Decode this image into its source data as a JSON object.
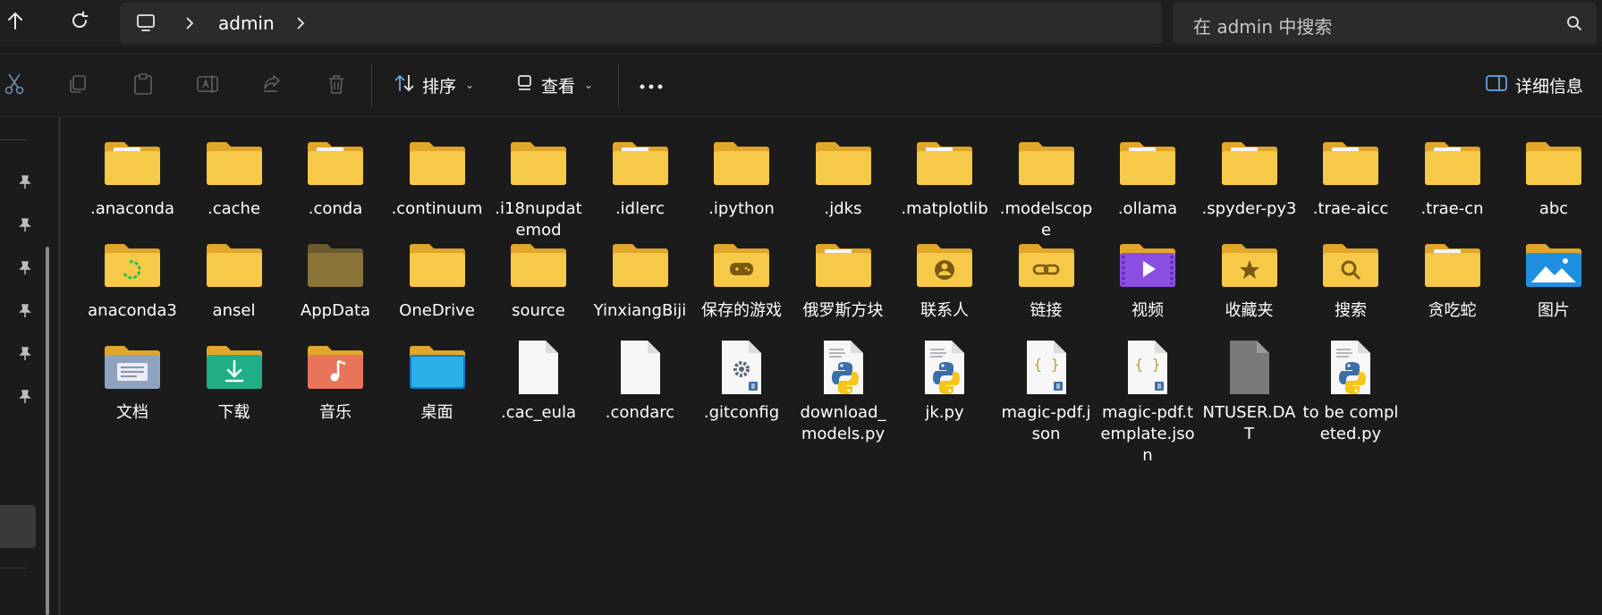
{
  "breadcrumb": {
    "current": "admin"
  },
  "search": {
    "placeholder": "在 admin 中搜索"
  },
  "toolbar": {
    "sort_label": "排序",
    "view_label": "查看",
    "details_label": "详细信息"
  },
  "colors": {
    "folder": "#f7c948",
    "folder_dark": "#e0a72a",
    "background": "#1b1b1b",
    "python_blue": "#3a6fa8",
    "python_yellow": "#f5c518"
  },
  "files": [
    {
      "name": ".anaconda",
      "icon": "folder-doc-icon"
    },
    {
      "name": ".cache",
      "icon": "folder-icon"
    },
    {
      "name": ".conda",
      "icon": "folder-doc-icon"
    },
    {
      "name": ".continuum",
      "icon": "folder-icon"
    },
    {
      "name": ".i18nupdatemod",
      "icon": "folder-icon"
    },
    {
      "name": ".idlerc",
      "icon": "folder-doc-icon"
    },
    {
      "name": ".ipython",
      "icon": "folder-icon"
    },
    {
      "name": ".jdks",
      "icon": "folder-icon"
    },
    {
      "name": ".matplotlib",
      "icon": "folder-doc-icon"
    },
    {
      "name": ".modelscope",
      "icon": "folder-icon"
    },
    {
      "name": ".ollama",
      "icon": "folder-doc-icon"
    },
    {
      "name": ".spyder-py3",
      "icon": "folder-doc-icon"
    },
    {
      "name": ".trae-aicc",
      "icon": "folder-doc-icon"
    },
    {
      "name": ".trae-cn",
      "icon": "folder-doc-icon"
    },
    {
      "name": "abc",
      "icon": "folder-icon"
    },
    {
      "name": "anaconda3",
      "icon": "folder-sync-icon"
    },
    {
      "name": "ansel",
      "icon": "folder-icon"
    },
    {
      "name": "AppData",
      "icon": "folder-hidden-icon"
    },
    {
      "name": "OneDrive",
      "icon": "folder-icon"
    },
    {
      "name": "source",
      "icon": "folder-icon"
    },
    {
      "name": "YinxiangBiji",
      "icon": "folder-icon"
    },
    {
      "name": "保存的游戏",
      "icon": "saved-games-folder-icon"
    },
    {
      "name": "俄罗斯方块",
      "icon": "folder-doc-icon"
    },
    {
      "name": "联系人",
      "icon": "contacts-folder-icon"
    },
    {
      "name": "链接",
      "icon": "links-folder-icon"
    },
    {
      "name": "视频",
      "icon": "videos-folder-icon"
    },
    {
      "name": "收藏夹",
      "icon": "favorites-folder-icon"
    },
    {
      "name": "搜索",
      "icon": "searches-folder-icon"
    },
    {
      "name": "贪吃蛇",
      "icon": "folder-doc-icon"
    },
    {
      "name": "图片",
      "icon": "pictures-folder-icon"
    },
    {
      "name": "文档",
      "icon": "documents-folder-icon"
    },
    {
      "name": "下载",
      "icon": "downloads-folder-icon"
    },
    {
      "name": "音乐",
      "icon": "music-folder-icon"
    },
    {
      "name": "桌面",
      "icon": "desktop-folder-icon"
    },
    {
      "name": ".cac_eula",
      "icon": "blank-file-icon"
    },
    {
      "name": ".condarc",
      "icon": "blank-file-icon"
    },
    {
      "name": ".gitconfig",
      "icon": "config-file-icon"
    },
    {
      "name": "download_models.py",
      "icon": "python-file-icon"
    },
    {
      "name": "jk.py",
      "icon": "python-file-icon"
    },
    {
      "name": "magic-pdf.json",
      "icon": "json-file-icon"
    },
    {
      "name": "magic-pdf.template.json",
      "icon": "json-file-icon"
    },
    {
      "name": "NTUSER.DAT",
      "icon": "system-file-icon"
    },
    {
      "name": "to be completed.py",
      "icon": "python-file-icon"
    }
  ]
}
